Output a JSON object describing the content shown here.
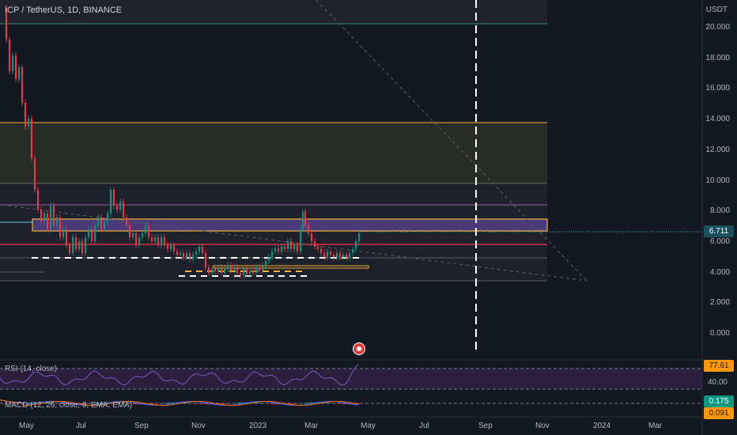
{
  "symbol_title": "ICP / TetherUS, 1D, BINANCE",
  "currency": "USDT",
  "y_axis_labels": [
    "20.000",
    "18.000",
    "16.000",
    "14.000",
    "12.000",
    "10.000",
    "8.000",
    "6.000",
    "4.000",
    "2.000",
    "0.000"
  ],
  "y_axis_values": [
    20,
    18,
    16,
    14,
    12,
    10,
    8,
    6,
    4,
    2,
    0
  ],
  "x_axis_labels": [
    "May",
    "Jul",
    "Sep",
    "Nov",
    "2023",
    "Mar",
    "May",
    "Jul",
    "Sep",
    "Nov",
    "2024",
    "Mar"
  ],
  "price_badge": {
    "value": "6.711",
    "color": "#1a4f5c"
  },
  "rsi": {
    "label": "RSI (14, close)",
    "value": "77.61",
    "level": "40.00",
    "badge_color": "#ff9800"
  },
  "macd": {
    "label": "MACD (12, 26, close, 9, EMA, EMA)",
    "macd_value": "0.175",
    "signal_value": "0.091",
    "macd_color": "#089981",
    "signal_color": "#ff9800"
  },
  "colors": {
    "background": "#141823",
    "up": "#089981",
    "down": "#f23645",
    "orange": "#f7b13a",
    "purple": "#4a3a7a"
  }
}
